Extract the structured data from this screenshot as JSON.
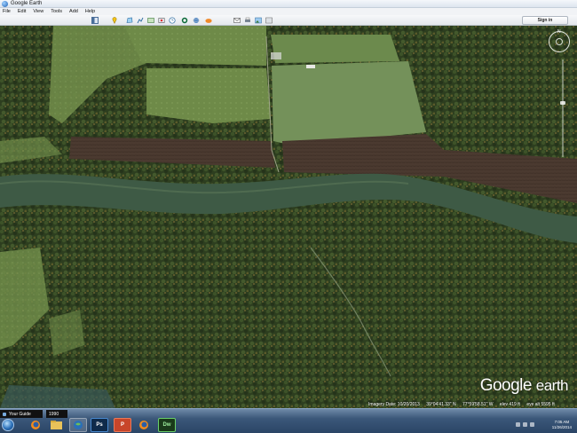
{
  "app": {
    "title": "Google Earth"
  },
  "menu": [
    "File",
    "Edit",
    "View",
    "Tools",
    "Add",
    "Help"
  ],
  "toolbar": {
    "buttons": [
      "hide-sidebar-icon",
      "placemark-icon",
      "polygon-icon",
      "path-icon",
      "image-overlay-icon",
      "record-tour-icon",
      "historical-imagery-icon",
      "sun-icon",
      "planets-icon",
      "ruler-icon",
      "email-icon",
      "print-icon",
      "save-image-icon",
      "maps-icon"
    ],
    "sign_in_label": "Sign in"
  },
  "navigation": {
    "compass_label": "N"
  },
  "status": {
    "imagery_date": "Imagery Date: 10/20/2013",
    "latitude": "39°04'41.33\" N",
    "longitude": "77°59'58.51\" W",
    "elevation": "elev  419 ft",
    "eye_alt": "eye alt  5595 ft"
  },
  "logo": {
    "word1": "Google",
    "word2": "earth"
  },
  "overlay_tabs": {
    "guide_label": "Your Guide",
    "year_label": "1990"
  },
  "taskbar": {
    "apps": [
      {
        "name": "firefox-app",
        "label": ""
      },
      {
        "name": "explorer-app",
        "label": ""
      },
      {
        "name": "google-earth-app",
        "label": ""
      },
      {
        "name": "photoshop-app",
        "label": "Ps"
      },
      {
        "name": "powerpoint-app",
        "label": "P"
      },
      {
        "name": "firefox-app-2",
        "label": ""
      },
      {
        "name": "dreamweaver-app",
        "label": "Dw"
      }
    ],
    "time": "7:05 AM",
    "date": "11/26/2014"
  },
  "colors": {
    "forest": "#2f4020",
    "field": "#6f8a4a",
    "river": "#3f5a44",
    "plowed": "#4a362c"
  }
}
